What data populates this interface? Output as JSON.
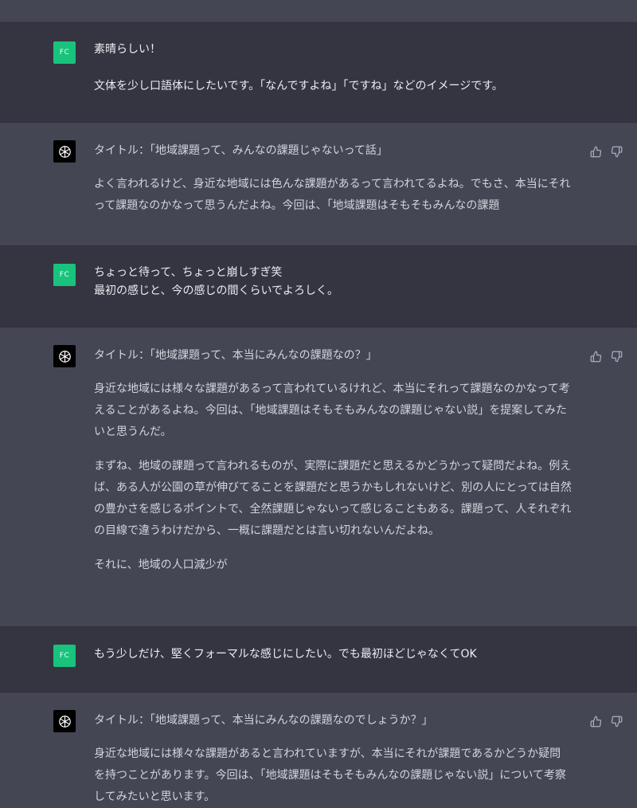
{
  "user_initials": "FC",
  "messages": [
    {
      "role": "user",
      "lines": [
        "素晴らしい！",
        "文体を少し口語体にしたいです。「なんですよね」「ですね」などのイメージです。"
      ]
    },
    {
      "role": "assistant",
      "title": "タイトル：「地域課題って、みんなの課題じゃないって話」",
      "paragraphs": [
        "よく言われるけど、身近な地域には色んな課題があるって言われてるよね。でもさ、本当にそれって課題なのかなって思うんだよね。今回は、「地域課題はそもそもみんなの課題"
      ]
    },
    {
      "role": "user",
      "lines": [
        "ちょっと待って、ちょっと崩しすぎ笑",
        "最初の感じと、今の感じの間くらいでよろしく。"
      ]
    },
    {
      "role": "assistant",
      "title": "タイトル：「地域課題って、本当にみんなの課題なの？」",
      "paragraphs": [
        "身近な地域には様々な課題があるって言われているけれど、本当にそれって課題なのかなって考えることがあるよね。今回は、「地域課題はそもそもみんなの課題じゃない説」を提案してみたいと思うんだ。",
        "まずね、地域の課題って言われるものが、実際に課題だと思えるかどうかって疑問だよね。例えば、ある人が公園の草が伸びてることを課題だと思うかもしれないけど、別の人にとっては自然の豊かさを感じるポイントで、全然課題じゃないって感じることもある。課題って、人それぞれの目線で違うわけだから、一概に課題だとは言い切れないんだよね。",
        "それに、地域の人口減少が"
      ]
    },
    {
      "role": "user",
      "lines": [
        "もう少しだけ、堅くフォーマルな感じにしたい。でも最初ほどじゃなくてOK"
      ]
    },
    {
      "role": "assistant",
      "title": "タイトル：「地域課題って、本当にみんなの課題なのでしょうか？」",
      "paragraphs": [
        "身近な地域には様々な課題があると言われていますが、本当にそれが課題であるかどうか疑問を持つことがあります。今回は、「地域課題はそもそもみんなの課題じゃない説」について考察してみたいと思います。"
      ]
    }
  ],
  "icons": {
    "assistant_avatar": "openai-logo-icon",
    "like": "thumbs-up-icon",
    "dislike": "thumbs-down-icon"
  },
  "colors": {
    "user_bg": "#343541",
    "assistant_bg": "#444654",
    "user_avatar": "#19c37d"
  }
}
